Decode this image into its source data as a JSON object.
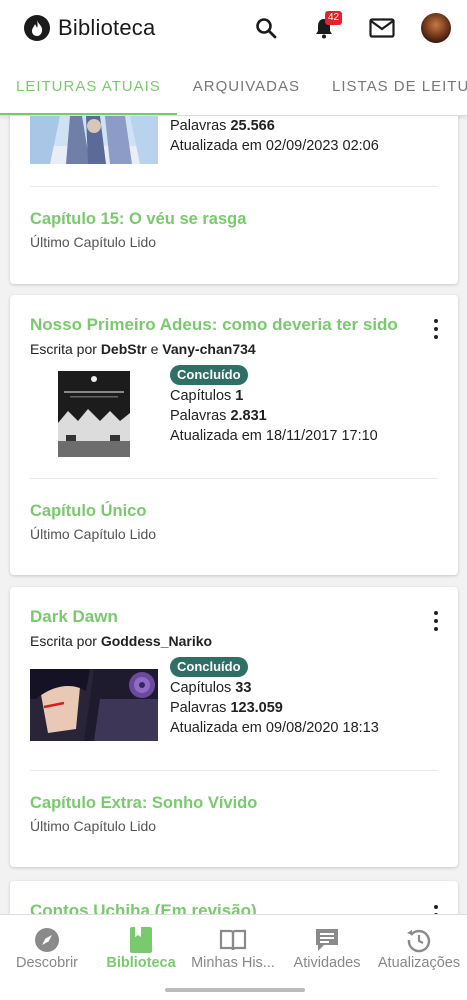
{
  "header": {
    "title": "Biblioteca",
    "notification_count": "42",
    "icons": [
      "flame-logo-icon",
      "search-icon",
      "bell-icon",
      "mail-icon",
      "avatar"
    ]
  },
  "tabs": [
    {
      "label": "LEITURAS ATUAIS",
      "active": true
    },
    {
      "label": "ARQUIVADAS",
      "active": false
    },
    {
      "label": "LISTAS DE LEITURA",
      "active": false
    }
  ],
  "stories": [
    {
      "words_label": "Palavras",
      "words": "25.566",
      "updated_label": "Atualizada em",
      "updated": "02/09/2023 02:06",
      "last_chapter": "Capítulo 15: O véu se rasga",
      "last_chapter_sub": "Último Capítulo Lido"
    },
    {
      "title": "Nosso Primeiro Adeus: como deveria ter sido",
      "written_by": "Escrita por",
      "author1": "DebStr",
      "conj": "e",
      "author2": "Vany-chan734",
      "status": "Concluído",
      "chapters_label": "Capítulos",
      "chapters": "1",
      "words_label": "Palavras",
      "words": "2.831",
      "updated_label": "Atualizada em",
      "updated": "18/11/2017 17:10",
      "last_chapter": "Capítulo Único",
      "last_chapter_sub": "Último Capítulo Lido"
    },
    {
      "title": "Dark Dawn",
      "written_by": "Escrita por",
      "author1": "Goddess_Nariko",
      "status": "Concluído",
      "chapters_label": "Capítulos",
      "chapters": "33",
      "words_label": "Palavras",
      "words": "123.059",
      "updated_label": "Atualizada em",
      "updated": "09/08/2020 18:13",
      "last_chapter": "Capítulo Extra: Sonho Vívido",
      "last_chapter_sub": "Último Capítulo Lido"
    },
    {
      "title": "Contos Uchiha (Em revisão)"
    }
  ],
  "bottom_nav": [
    {
      "label": "Descobrir",
      "icon": "compass-icon",
      "active": false
    },
    {
      "label": "Biblioteca",
      "icon": "bookmark-book-icon",
      "active": true
    },
    {
      "label": "Minhas His...",
      "icon": "open-book-icon",
      "active": false
    },
    {
      "label": "Atividades",
      "icon": "chat-icon",
      "active": false
    },
    {
      "label": "Atualizações",
      "icon": "history-icon",
      "active": false
    }
  ],
  "colors": {
    "accent": "#7bc96f",
    "badge_bg": "#2f6f66",
    "notification": "#e0242a"
  }
}
